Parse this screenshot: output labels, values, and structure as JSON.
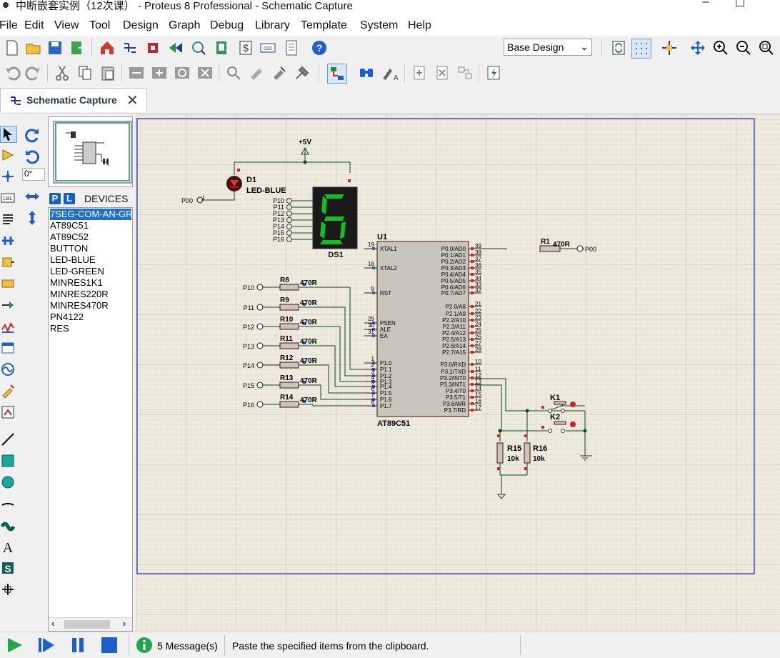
{
  "window": {
    "title": "中断嵌套实例（12次课） - Proteus 8 Professional - Schematic Capture",
    "minimize": "–",
    "maximize": "☐"
  },
  "menu": [
    "File",
    "Edit",
    "View",
    "Tool",
    "Design",
    "Graph",
    "Debug",
    "Library",
    "Template",
    "System",
    "Help"
  ],
  "toolbar": {
    "design_select": "Base Design",
    "icons_row1": [
      "new-file-icon",
      "open-folder-icon",
      "save-icon",
      "import-icon",
      "home-icon",
      "schematic-icon",
      "pcb-icon",
      "3d-viewer-icon",
      "gerber-icon",
      "bom-icon",
      "cost-icon",
      "vsm-studio-icon",
      "notes-icon",
      "help-icon",
      "refresh-icon",
      "grid-icon",
      "origin-icon",
      "pan-icon",
      "zoom-in-icon",
      "zoom-out-icon",
      "zoom-all-icon"
    ],
    "icons_row2": [
      "undo-icon",
      "redo-icon",
      "cut-icon",
      "copy-icon",
      "paste-icon",
      "block-copy-icon",
      "block-move-icon",
      "block-rotate-icon",
      "block-delete-icon",
      "pick-device-icon",
      "make-device-icon",
      "package-tool-icon",
      "decompose-icon",
      "wire-autorouter-icon",
      "search-icon",
      "property-assign-icon",
      "new-sheet-icon",
      "remove-sheet-icon",
      "zoom-child-icon",
      "electrical-check-icon"
    ]
  },
  "tab": {
    "label": "Schematic Capture",
    "close": "✕"
  },
  "left_panel": {
    "rotation": "0°"
  },
  "devices": {
    "p_button": "P",
    "l_button": "L",
    "title": "DEVICES",
    "items": [
      "7SEG-COM-AN-GRN",
      "AT89C51",
      "AT89C52",
      "BUTTON",
      "LED-BLUE",
      "LED-GREEN",
      "MINRES1K1",
      "MINRES220R",
      "MINRES470R",
      "PN4122",
      "RES"
    ],
    "selected_index": 0
  },
  "schematic": {
    "power_label": "+5V",
    "d1": {
      "ref": "D1",
      "value": "LED-BLUE",
      "net": "P00"
    },
    "ds1": {
      "ref": "DS1",
      "digit": "6",
      "pins": [
        "P10",
        "P11",
        "P12",
        "P13",
        "P14",
        "P15",
        "P16"
      ]
    },
    "u1": {
      "ref": "U1",
      "value": "AT89C51",
      "left_pins": [
        {
          "num": "19",
          "name": "XTAL1"
        },
        {
          "num": "18",
          "name": "XTAL2"
        },
        {
          "num": "9",
          "name": "RST"
        },
        {
          "num": "29",
          "name": "PSEN"
        },
        {
          "num": "30",
          "name": "ALE"
        },
        {
          "num": "31",
          "name": "EA"
        },
        {
          "num": "1",
          "name": "P1.0"
        },
        {
          "num": "2",
          "name": "P1.1"
        },
        {
          "num": "3",
          "name": "P1.2"
        },
        {
          "num": "4",
          "name": "P1.3"
        },
        {
          "num": "5",
          "name": "P1.4"
        },
        {
          "num": "6",
          "name": "P1.5"
        },
        {
          "num": "7",
          "name": "P1.6"
        },
        {
          "num": "8",
          "name": "P1.7"
        }
      ],
      "right_pins": [
        {
          "num": "39",
          "name": "P0.0/AD0"
        },
        {
          "num": "38",
          "name": "P0.1/AD1"
        },
        {
          "num": "37",
          "name": "P0.2/AD2"
        },
        {
          "num": "36",
          "name": "P0.3/AD3"
        },
        {
          "num": "35",
          "name": "P0.4/AD4"
        },
        {
          "num": "34",
          "name": "P0.5/AD5"
        },
        {
          "num": "33",
          "name": "P0.6/AD6"
        },
        {
          "num": "32",
          "name": "P0.7/AD7"
        },
        {
          "num": "21",
          "name": "P2.0/A8"
        },
        {
          "num": "22",
          "name": "P2.1/A9"
        },
        {
          "num": "23",
          "name": "P2.2/A10"
        },
        {
          "num": "24",
          "name": "P2.3/A11"
        },
        {
          "num": "25",
          "name": "P2.4/A12"
        },
        {
          "num": "26",
          "name": "P2.5/A13"
        },
        {
          "num": "27",
          "name": "P2.6/A14"
        },
        {
          "num": "28",
          "name": "P2.7/A15"
        },
        {
          "num": "10",
          "name": "P3.0/RXD"
        },
        {
          "num": "11",
          "name": "P3.1/TXD"
        },
        {
          "num": "12",
          "name": "P3.2/INT0"
        },
        {
          "num": "13",
          "name": "P3.3/INT1"
        },
        {
          "num": "14",
          "name": "P3.4/T0"
        },
        {
          "num": "15",
          "name": "P3.5/T1"
        },
        {
          "num": "16",
          "name": "P3.6/WR"
        },
        {
          "num": "17",
          "name": "P3.7/RD"
        }
      ]
    },
    "r1": {
      "ref": "R1",
      "value": "470R",
      "net": "P00"
    },
    "resistors": [
      {
        "ref": "R8",
        "value": "470R",
        "net": "P10"
      },
      {
        "ref": "R9",
        "value": "470R",
        "net": "P11"
      },
      {
        "ref": "R10",
        "value": "470R",
        "net": "P12"
      },
      {
        "ref": "R11",
        "value": "470R",
        "net": "P13"
      },
      {
        "ref": "R12",
        "value": "470R",
        "net": "P14"
      },
      {
        "ref": "R13",
        "value": "470R",
        "net": "P15"
      },
      {
        "ref": "R14",
        "value": "470R",
        "net": "P16"
      }
    ],
    "k1": "K1",
    "k2": "K2",
    "r15": {
      "ref": "R15",
      "value": "10k"
    },
    "r16": {
      "ref": "R16",
      "value": "10k"
    }
  },
  "statusbar": {
    "messages": "5 Message(s)",
    "status": "Paste the specified items from the clipboard."
  }
}
